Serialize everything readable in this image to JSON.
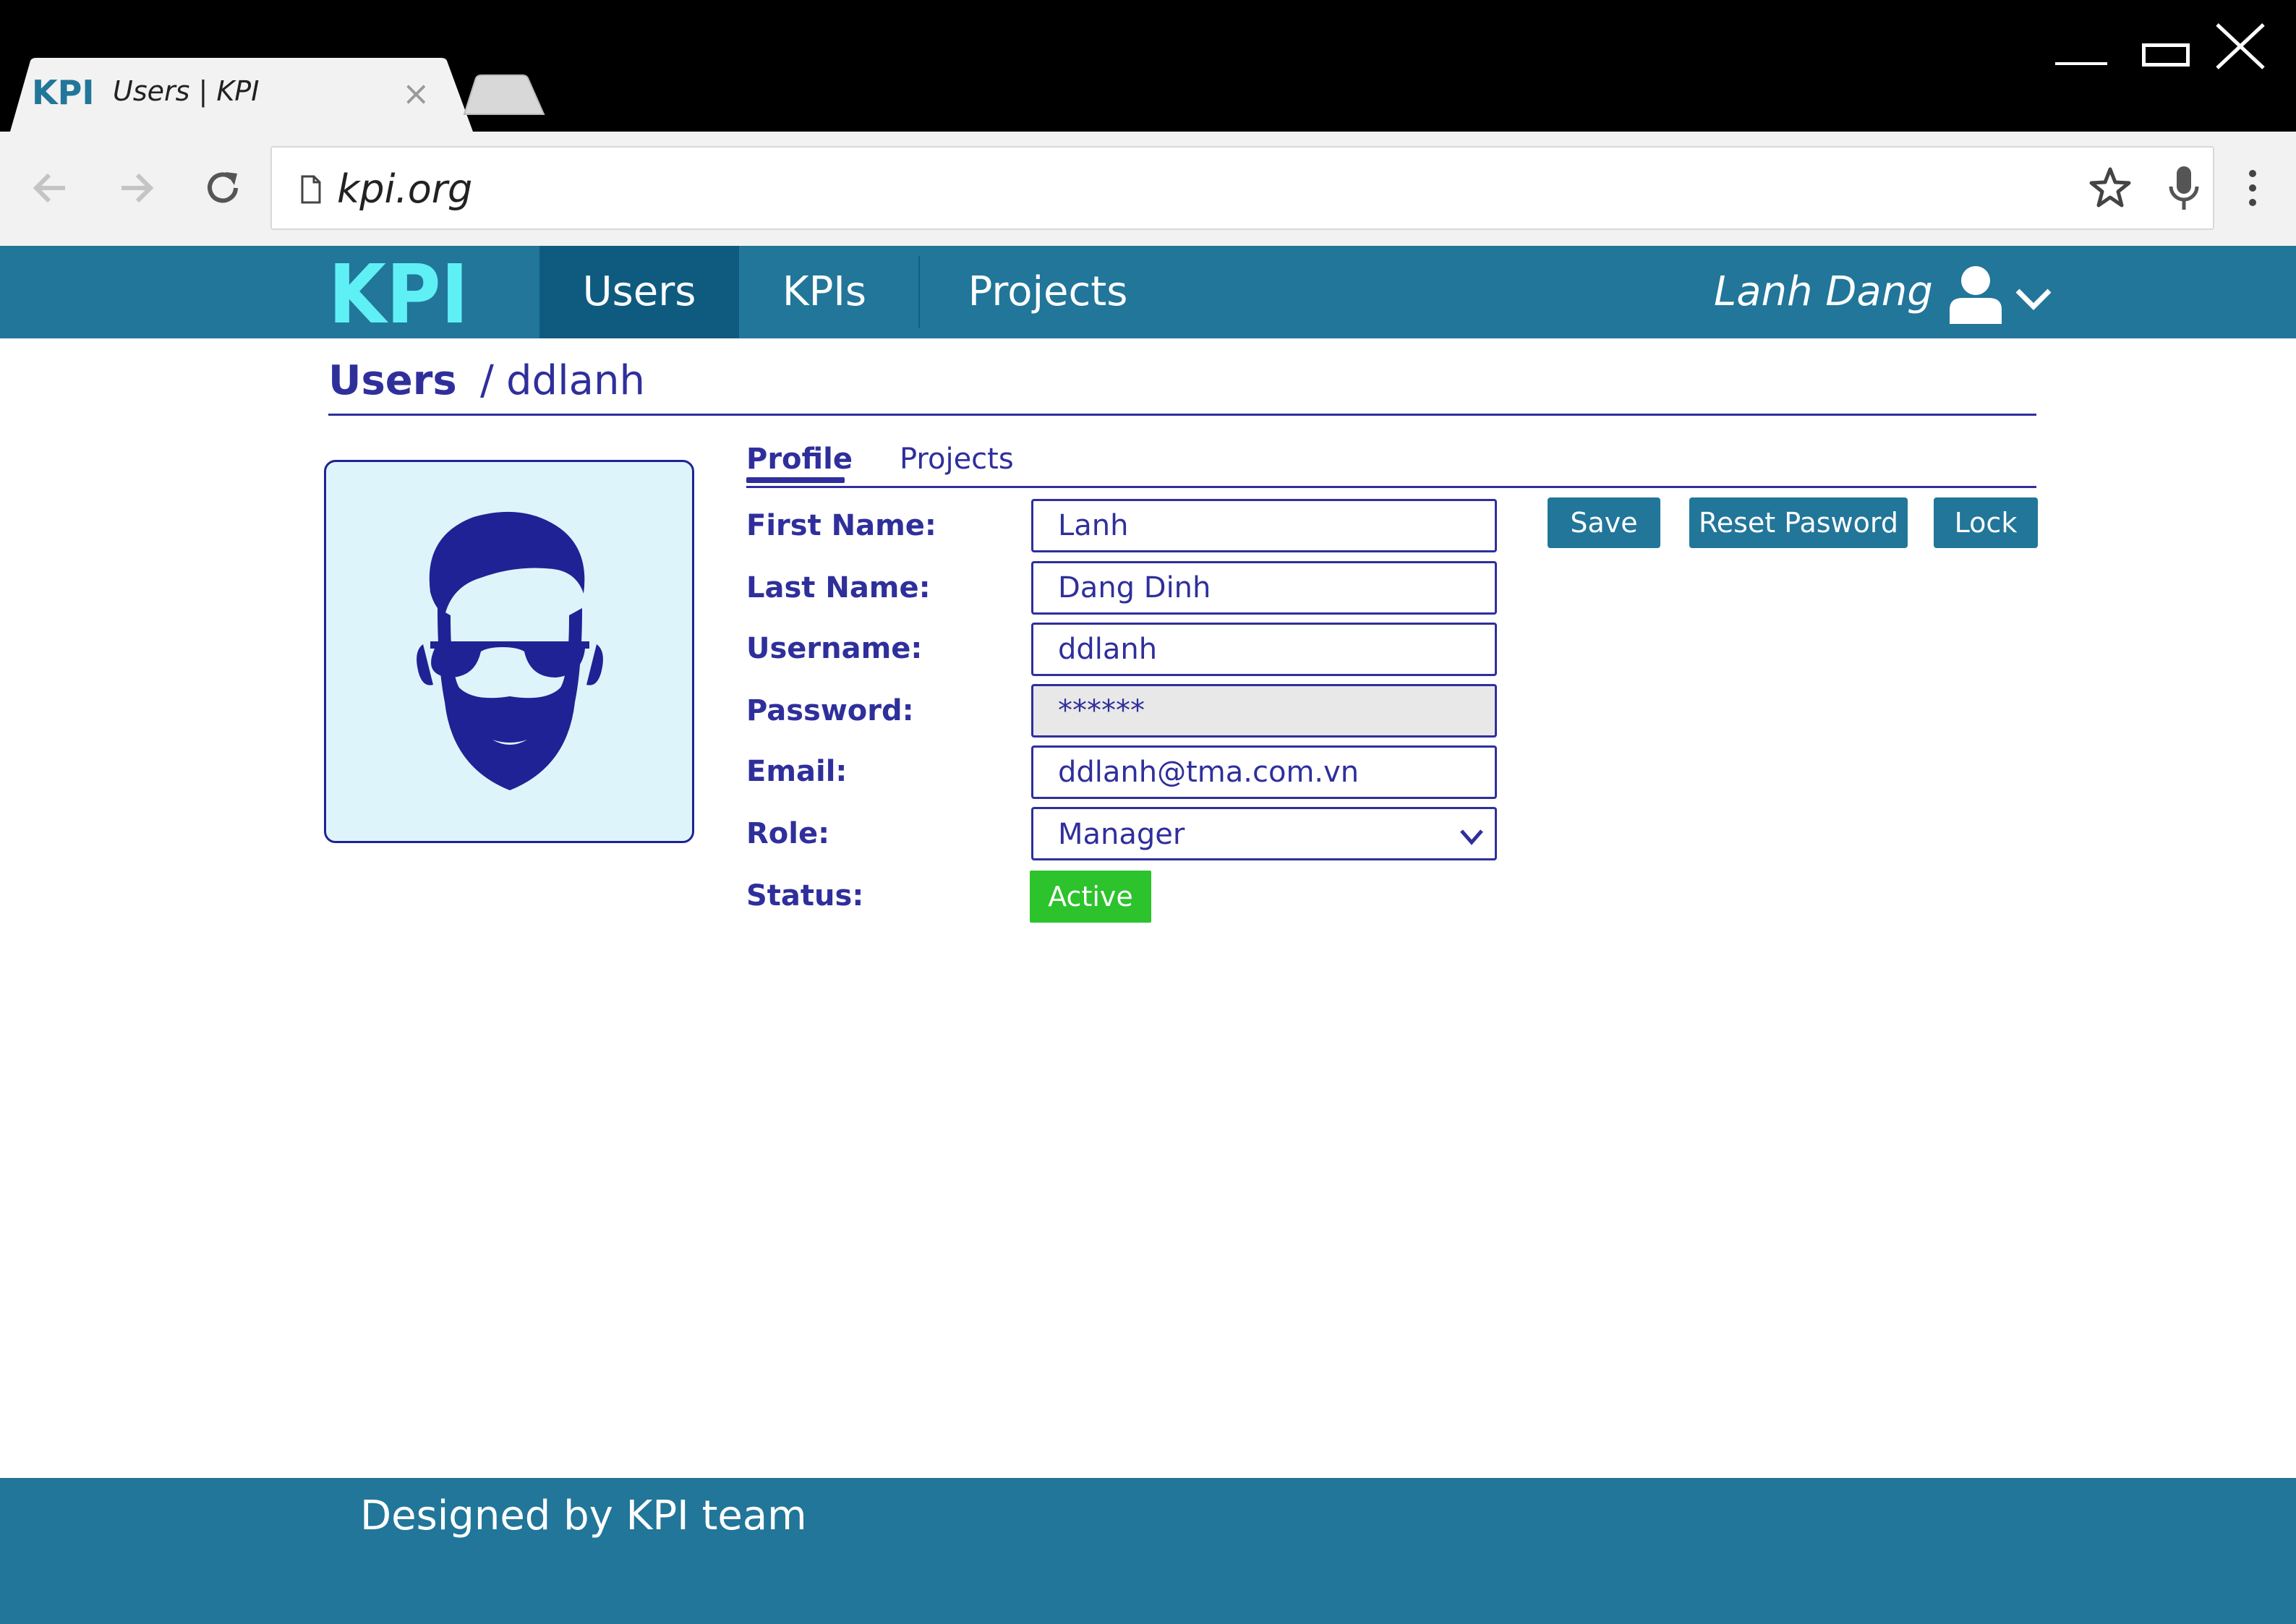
{
  "browser": {
    "tab_title": "Users | KPI",
    "tab_logo": "KPI",
    "tab_close": "×",
    "address": "kpi.org",
    "icons": [
      "back-arrow-icon",
      "forward-arrow-icon",
      "reload-icon",
      "page-icon",
      "star-icon",
      "microphone-icon",
      "more-vert-icon"
    ]
  },
  "app": {
    "brand": "KPI",
    "nav": [
      {
        "label": "Users",
        "active": true
      },
      {
        "label": "KPIs",
        "active": false
      },
      {
        "label": "Projects",
        "active": false
      }
    ],
    "user_name": "Lanh Dang",
    "colors": {
      "nav": "#217699",
      "nav_active": "#0f5b7f",
      "brand": "#5ff0f5",
      "text": "#2f2f9c",
      "status_active": "#2cc32c"
    }
  },
  "breadcrumb": {
    "root": "Users",
    "separator": "/",
    "leaf": "ddlanh"
  },
  "tabs": [
    {
      "label": "Profile",
      "active": true
    },
    {
      "label": "Projects",
      "active": false
    }
  ],
  "form": {
    "first_name": {
      "label": "First Name:",
      "value": "Lanh"
    },
    "last_name": {
      "label": "Last Name:",
      "value": "Dang Dinh"
    },
    "username": {
      "label": "Username:",
      "value": "ddlanh"
    },
    "password": {
      "label": "Password:",
      "value": "******"
    },
    "email": {
      "label": "Email:",
      "value": "ddlanh@tma.com.vn"
    },
    "role": {
      "label": "Role:",
      "value": "Manager"
    },
    "status": {
      "label": "Status:",
      "value": "Active"
    }
  },
  "actions": {
    "save": "Save",
    "reset_password": "Reset Pasword",
    "lock": "Lock"
  },
  "footer": {
    "text": "Designed by KPI team"
  }
}
